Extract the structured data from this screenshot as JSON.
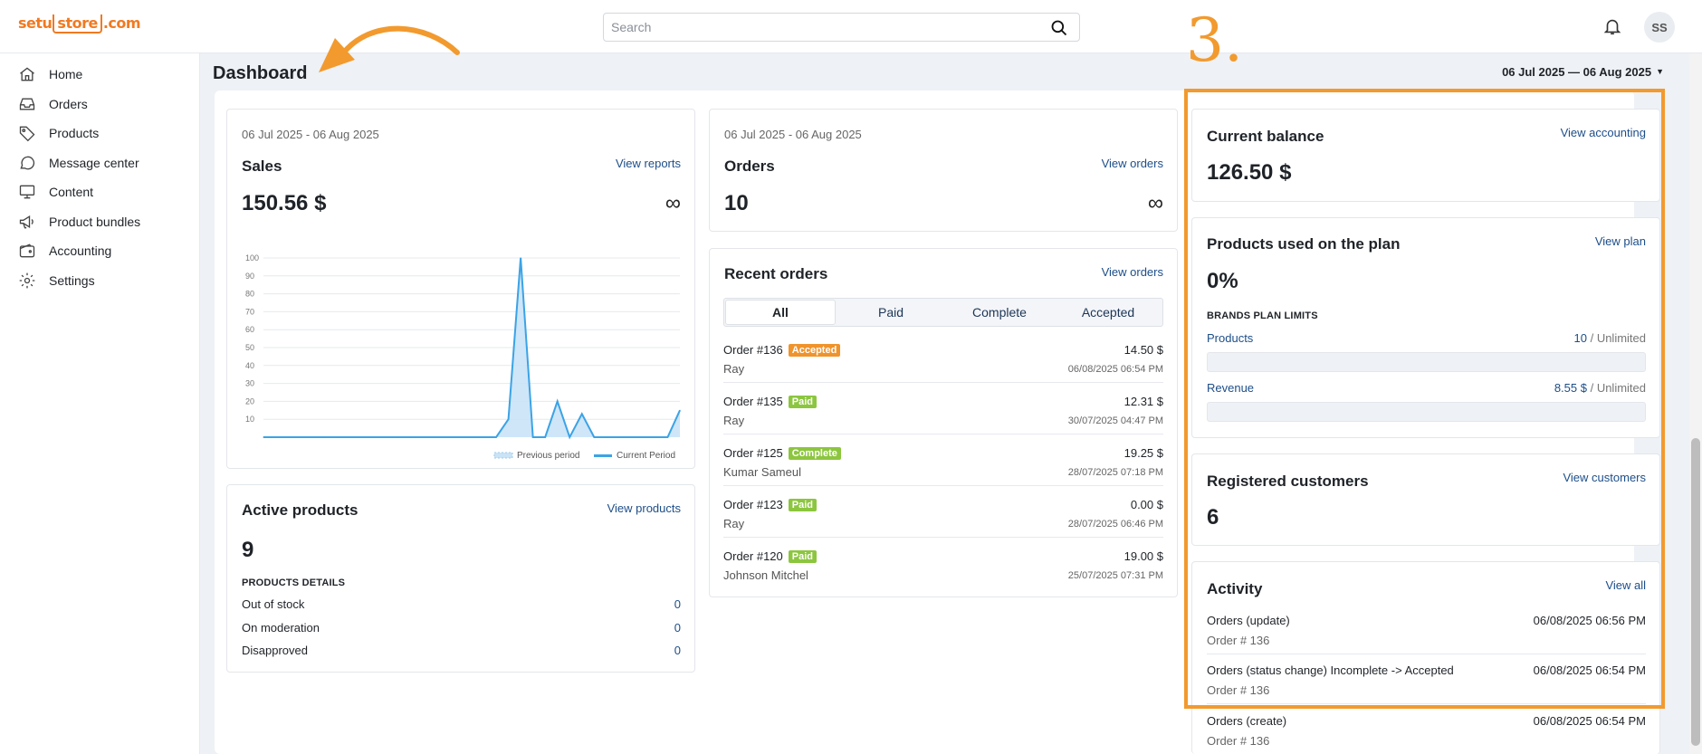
{
  "brand": {
    "logo_pre": "setu",
    "logo_mid": "store",
    "logo_post": ".com"
  },
  "search": {
    "placeholder": "Search"
  },
  "user": {
    "initials": "SS"
  },
  "sidebar": {
    "items": [
      {
        "label": "Home",
        "icon": "home-icon"
      },
      {
        "label": "Orders",
        "icon": "inbox-icon"
      },
      {
        "label": "Products",
        "icon": "tag-icon"
      },
      {
        "label": "Message center",
        "icon": "chat-icon"
      },
      {
        "label": "Content",
        "icon": "monitor-icon"
      },
      {
        "label": "Product bundles",
        "icon": "megaphone-icon"
      },
      {
        "label": "Accounting",
        "icon": "wallet-icon"
      },
      {
        "label": "Settings",
        "icon": "gear-icon"
      }
    ]
  },
  "page": {
    "title": "Dashboard",
    "date_range": "06 Jul 2025 — 06 Aug 2025"
  },
  "sales": {
    "date": "06 Jul 2025 - 06 Aug 2025",
    "title": "Sales",
    "link": "View reports",
    "value": "150.56 $",
    "infinity": "∞",
    "legend_prev": "Previous period",
    "legend_curr": "Current Period"
  },
  "chart_data": {
    "type": "area",
    "ylim": [
      0,
      100
    ],
    "yticks": [
      10,
      20,
      30,
      40,
      50,
      60,
      70,
      80,
      90,
      100
    ],
    "series": [
      {
        "name": "Current Period",
        "values": [
          0,
          0,
          0,
          0,
          0,
          0,
          0,
          0,
          0,
          0,
          0,
          0,
          0,
          0,
          0,
          0,
          0,
          0,
          0,
          0,
          10,
          100,
          0,
          0,
          20,
          0,
          13,
          0,
          0,
          0,
          0,
          0,
          0,
          0,
          15
        ]
      },
      {
        "name": "Previous period",
        "values": [
          0,
          0,
          0,
          0,
          0,
          0,
          0,
          0,
          0,
          0,
          0,
          0,
          0,
          0,
          0,
          0,
          0,
          0,
          0,
          0,
          0,
          0,
          0,
          0,
          0,
          0,
          0,
          0,
          0,
          0,
          0,
          0,
          0,
          0,
          0
        ]
      }
    ],
    "colors": {
      "current": "#3ba3e6",
      "fill": "#c9e3f7"
    }
  },
  "orders_card": {
    "date": "06 Jul 2025 - 06 Aug 2025",
    "title": "Orders",
    "link": "View orders",
    "value": "10",
    "infinity": "∞"
  },
  "active_products": {
    "title": "Active products",
    "link": "View products",
    "value": "9",
    "details_label": "PRODUCTS DETAILS",
    "rows": [
      {
        "label": "Out of stock",
        "value": "0"
      },
      {
        "label": "On moderation",
        "value": "0"
      },
      {
        "label": "Disapproved",
        "value": "0"
      }
    ]
  },
  "recent_orders": {
    "title": "Recent orders",
    "link": "View orders",
    "tabs": [
      "All",
      "Paid",
      "Complete",
      "Accepted"
    ],
    "orders": [
      {
        "name": "Order #136",
        "status": "Accepted",
        "color": "#f0932b",
        "price": "14.50 $",
        "customer": "Ray",
        "date": "06/08/2025 06:54 PM"
      },
      {
        "name": "Order #135",
        "status": "Paid",
        "color": "#8cc63f",
        "price": "12.31 $",
        "customer": "Ray",
        "date": "30/07/2025 04:47 PM"
      },
      {
        "name": "Order #125",
        "status": "Complete",
        "color": "#8cc63f",
        "price": "19.25 $",
        "customer": "Kumar Sameul",
        "date": "28/07/2025 07:18 PM"
      },
      {
        "name": "Order #123",
        "status": "Paid",
        "color": "#8cc63f",
        "price": "0.00 $",
        "customer": "Ray",
        "date": "28/07/2025 06:46 PM"
      },
      {
        "name": "Order #120",
        "status": "Paid",
        "color": "#8cc63f",
        "price": "19.00 $",
        "customer": "Johnson Mitchel",
        "date": "25/07/2025 07:31 PM"
      }
    ]
  },
  "balance": {
    "title": "Current balance",
    "link": "View accounting",
    "value": "126.50 $"
  },
  "plan": {
    "title": "Products used on the plan",
    "link": "View plan",
    "value": "0%",
    "limits_label": "BRANDS PLAN LIMITS",
    "limits": [
      {
        "label": "Products",
        "used": "10",
        "sep": " / ",
        "max": "Unlimited",
        "fill": 0
      },
      {
        "label": "Revenue",
        "used": "8.55 $",
        "sep": " / ",
        "max": "Unlimited",
        "fill": 0
      }
    ]
  },
  "customers": {
    "title": "Registered customers",
    "link": "View customers",
    "value": "6"
  },
  "activity": {
    "title": "Activity",
    "link": "View all",
    "items": [
      {
        "title": "Orders (update)",
        "sub": "Order # 136",
        "date": "06/08/2025 06:56 PM"
      },
      {
        "title": "Orders (status change) Incomplete -> Accepted",
        "sub": "Order # 136",
        "date": "06/08/2025 06:54 PM"
      },
      {
        "title": "Orders (create)",
        "sub": "Order # 136",
        "date": "06/08/2025 06:54 PM"
      }
    ]
  },
  "annotation": {
    "number": "3.",
    "color": "#f29a2e"
  }
}
